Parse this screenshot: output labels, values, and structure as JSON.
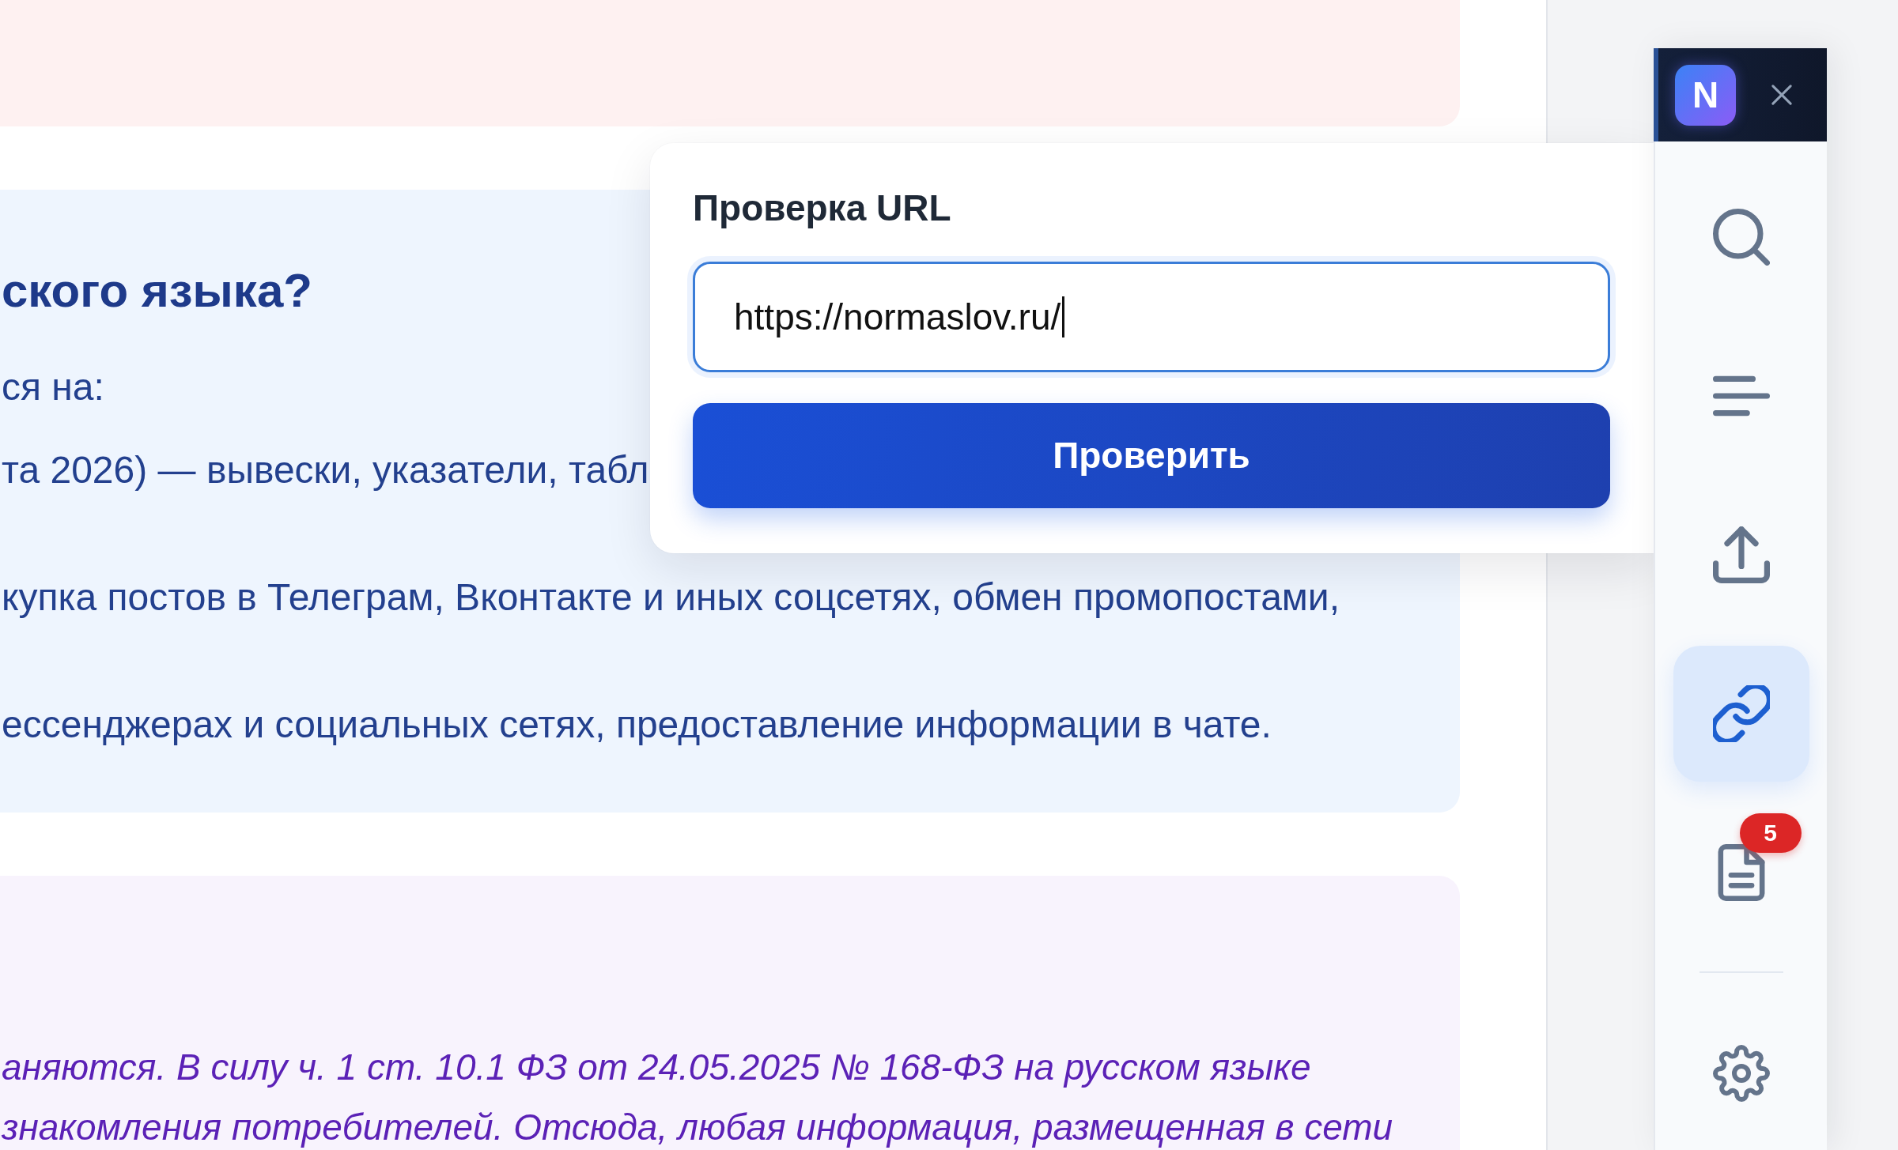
{
  "content": {
    "cards": [
      {
        "kind": "alert"
      },
      {
        "kind": "info",
        "heading": "ского языка?",
        "intro": "ся на:",
        "items": [
          "та 2026) — вывески, указатели, табл",
          "купка постов в Телеграм, Вконтакте и иных соцсетях, обмен промопостами,",
          "ессенджерах и социальных сетях, предоставление информации в чате."
        ]
      },
      {
        "kind": "note",
        "lines": [
          "аняются. В силу ч. 1 ст. 10.1 ФЗ от 24.05.2025 № 168-ФЗ на русском языке",
          "знакомления потребителей. Отсюда, любая информация, размещенная в сети"
        ]
      }
    ]
  },
  "popup": {
    "title": "Проверка URL",
    "url_field": {
      "value": "https://normaslov.ru/",
      "focused": true
    },
    "button": "Проверить"
  },
  "toolbar": {
    "logo": "N",
    "items": [
      {
        "kind": "search",
        "selected": false
      },
      {
        "kind": "menu",
        "selected": false
      },
      {
        "kind": "upload",
        "selected": false
      },
      {
        "kind": "link",
        "selected": true
      },
      {
        "kind": "document",
        "selected": false,
        "badge": "5"
      }
    ],
    "bottom_items": [
      {
        "kind": "settings",
        "selected": false
      }
    ]
  }
}
